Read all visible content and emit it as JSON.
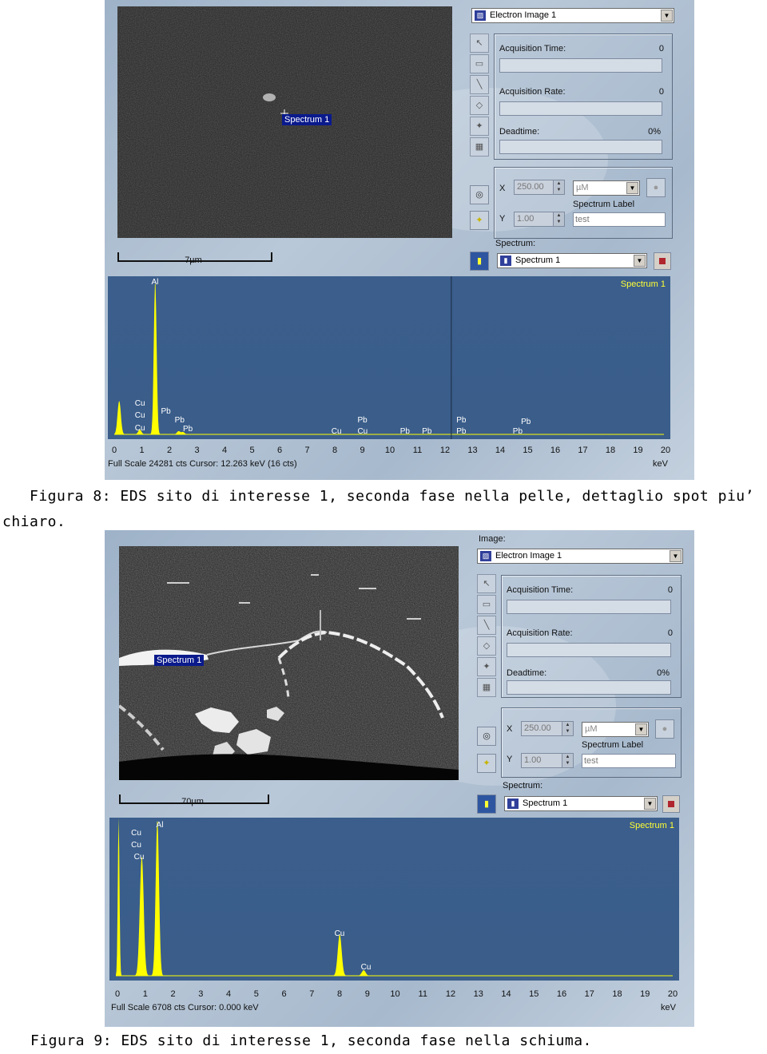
{
  "figure8": {
    "image_label": "",
    "image_dropdown": "Electron Image 1",
    "acq_time_label": "Acquisition Time:",
    "acq_time_value": "0",
    "acq_rate_label": "Acquisition Rate:",
    "acq_rate_value": "0",
    "deadtime_label": "Deadtime:",
    "deadtime_value": "0%",
    "x_label": "X",
    "x_value": "250.00",
    "unit_value": "µM",
    "spectrum_label_caption": "Spectrum Label",
    "y_label": "Y",
    "y_value": "1.00",
    "spectrum_label_value": "test",
    "spectrum_caption": "Spectrum:",
    "spectrum_dropdown": "Spectrum 1",
    "sem_marker_label": "Spectrum 1",
    "scale_bar_text": "7µm",
    "spectrum_title": "Spectrum 1",
    "peak_labels": [
      "Al",
      "Cu",
      "Cu",
      "Cu",
      "Pb",
      "Pb",
      "Pb",
      "Cu",
      "Cu",
      "Pb",
      "Pb",
      "Pb",
      "Pb",
      "Pb",
      "Pb",
      "Pb"
    ],
    "ticks": [
      "0",
      "1",
      "2",
      "3",
      "4",
      "5",
      "6",
      "7",
      "8",
      "9",
      "10",
      "11",
      "12",
      "13",
      "14",
      "15",
      "16",
      "17",
      "18",
      "19",
      "20"
    ],
    "full_scale": "Full Scale 24281 cts  Cursor: 12.263 keV (16 cts)",
    "unit": "keV",
    "caption": "Figura 8: EDS sito di interesse 1, seconda fase nella pelle, dettaglio spot piu’",
    "caption_cont": "chiaro."
  },
  "figure9": {
    "image_label": "Image:",
    "image_dropdown": "Electron Image 1",
    "acq_time_label": "Acquisition Time:",
    "acq_time_value": "0",
    "acq_rate_label": "Acquisition Rate:",
    "acq_rate_value": "0",
    "deadtime_label": "Deadtime:",
    "deadtime_value": "0%",
    "x_label": "X",
    "x_value": "250.00",
    "unit_value": "µM",
    "spectrum_label_caption": "Spectrum Label",
    "y_label": "Y",
    "y_value": "1.00",
    "spectrum_label_value": "test",
    "spectrum_caption": "Spectrum:",
    "spectrum_dropdown": "Spectrum 1",
    "sem_marker_label": "Spectrum 1",
    "scale_bar_text": "70µm",
    "spectrum_title": "Spectrum 1",
    "peak_labels": [
      "Cu",
      "Cu",
      "Cu",
      "Al",
      "Cu",
      "Cu"
    ],
    "ticks": [
      "0",
      "1",
      "2",
      "3",
      "4",
      "5",
      "6",
      "7",
      "8",
      "9",
      "10",
      "11",
      "12",
      "13",
      "14",
      "15",
      "16",
      "17",
      "18",
      "19",
      "20"
    ],
    "full_scale": "Full Scale 6708 cts  Cursor: 0.000 keV",
    "unit": "keV",
    "caption": "Figura 9: EDS sito di interesse 1, seconda fase nella schiuma."
  },
  "colors": {
    "spectrum_fill": "#ffff00",
    "spectrum_bg": "#3b5e8c",
    "label_yellow": "#ffff33",
    "marker_bg": "#0a1a8c"
  }
}
